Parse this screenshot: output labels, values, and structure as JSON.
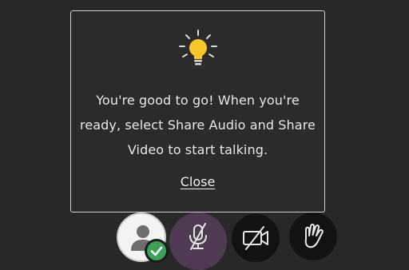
{
  "tip": {
    "message": "You're good to go! When you're ready, select Share Audio and Share Video to start talking.",
    "close_label": "Close",
    "icon": "lightbulb-icon"
  },
  "controls": {
    "avatar": {
      "icon": "user-icon",
      "status_icon": "checkmark-icon"
    },
    "audio": {
      "icon": "microphone-muted-icon"
    },
    "video": {
      "icon": "camera-off-icon"
    },
    "hand": {
      "icon": "raise-hand-icon"
    }
  },
  "colors": {
    "background": "#282828",
    "card_border": "#cfcfcf",
    "text": "#e8e8e8",
    "bulb": "#f7c629",
    "mic_button": "#4e3a51",
    "check": "#3aa357"
  }
}
